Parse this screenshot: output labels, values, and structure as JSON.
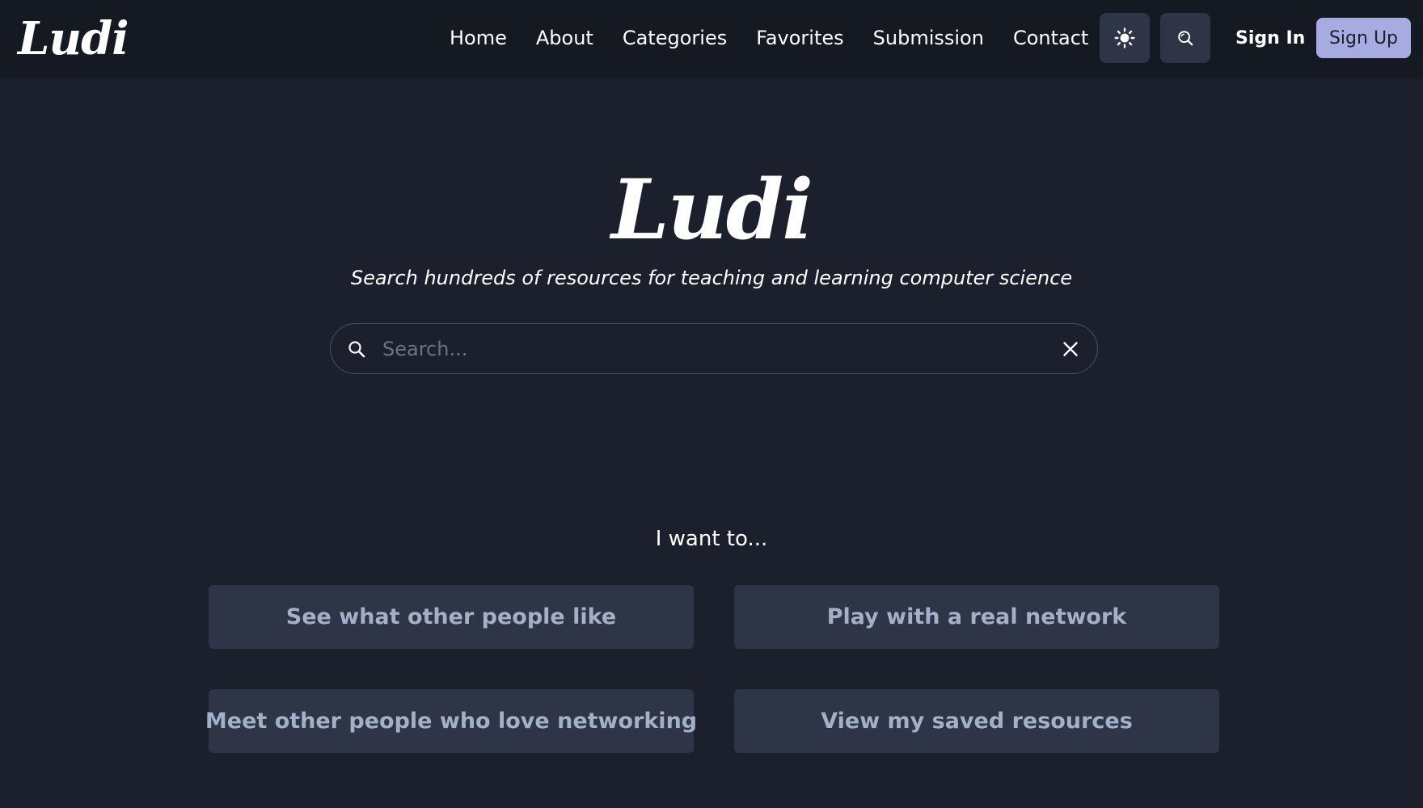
{
  "brand": {
    "logo_text": "Ludi"
  },
  "nav": {
    "items": [
      {
        "label": "Home"
      },
      {
        "label": "About"
      },
      {
        "label": "Categories"
      },
      {
        "label": "Favorites"
      },
      {
        "label": "Submission"
      },
      {
        "label": "Contact"
      }
    ],
    "theme_toggle_icon": "sun-icon",
    "search_icon": "search-icon",
    "sign_in_label": "Sign In",
    "sign_up_label": "Sign Up"
  },
  "hero": {
    "title": "Ludi",
    "subtitle": "Search hundreds of resources for teaching and learning computer science"
  },
  "search": {
    "placeholder": "Search...",
    "value": "",
    "search_icon": "search-icon",
    "clear_icon": "close-icon"
  },
  "actions": {
    "heading": "I want to...",
    "buttons": [
      {
        "label": "See what other people like"
      },
      {
        "label": "Play with a real network"
      },
      {
        "label": "Meet other people who love networking"
      },
      {
        "label": "View my saved resources"
      }
    ]
  },
  "colors": {
    "background": "#1b202c",
    "header_background": "#151922",
    "button_background": "#2d3546",
    "button_text": "#a3b0c7",
    "sign_up_background": "#a7abdf"
  }
}
